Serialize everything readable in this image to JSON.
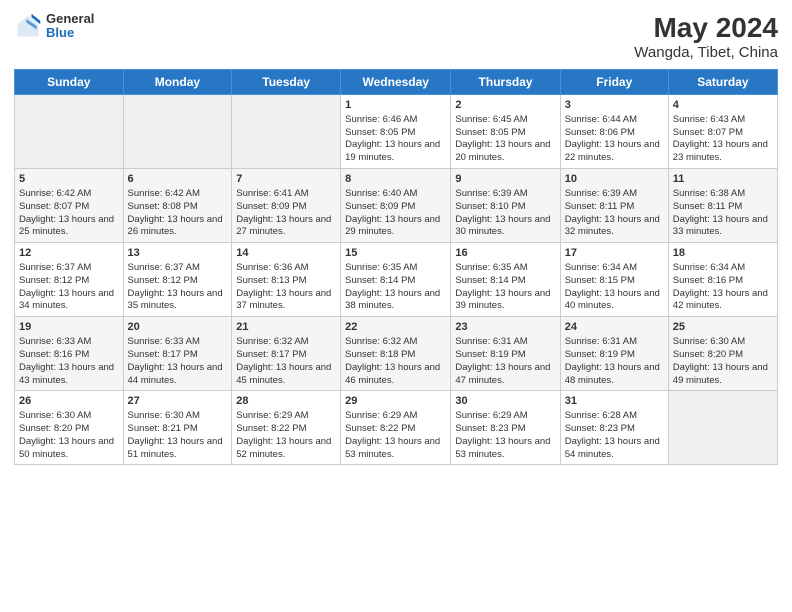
{
  "header": {
    "logo_general": "General",
    "logo_blue": "Blue",
    "title": "May 2024",
    "subtitle": "Wangda, Tibet, China"
  },
  "weekdays": [
    "Sunday",
    "Monday",
    "Tuesday",
    "Wednesday",
    "Thursday",
    "Friday",
    "Saturday"
  ],
  "rows": [
    [
      {
        "day": "",
        "info": ""
      },
      {
        "day": "",
        "info": ""
      },
      {
        "day": "",
        "info": ""
      },
      {
        "day": "1",
        "info": "Sunrise: 6:46 AM\nSunset: 8:05 PM\nDaylight: 13 hours and 19 minutes."
      },
      {
        "day": "2",
        "info": "Sunrise: 6:45 AM\nSunset: 8:05 PM\nDaylight: 13 hours and 20 minutes."
      },
      {
        "day": "3",
        "info": "Sunrise: 6:44 AM\nSunset: 8:06 PM\nDaylight: 13 hours and 22 minutes."
      },
      {
        "day": "4",
        "info": "Sunrise: 6:43 AM\nSunset: 8:07 PM\nDaylight: 13 hours and 23 minutes."
      }
    ],
    [
      {
        "day": "5",
        "info": "Sunrise: 6:42 AM\nSunset: 8:07 PM\nDaylight: 13 hours and 25 minutes."
      },
      {
        "day": "6",
        "info": "Sunrise: 6:42 AM\nSunset: 8:08 PM\nDaylight: 13 hours and 26 minutes."
      },
      {
        "day": "7",
        "info": "Sunrise: 6:41 AM\nSunset: 8:09 PM\nDaylight: 13 hours and 27 minutes."
      },
      {
        "day": "8",
        "info": "Sunrise: 6:40 AM\nSunset: 8:09 PM\nDaylight: 13 hours and 29 minutes."
      },
      {
        "day": "9",
        "info": "Sunrise: 6:39 AM\nSunset: 8:10 PM\nDaylight: 13 hours and 30 minutes."
      },
      {
        "day": "10",
        "info": "Sunrise: 6:39 AM\nSunset: 8:11 PM\nDaylight: 13 hours and 32 minutes."
      },
      {
        "day": "11",
        "info": "Sunrise: 6:38 AM\nSunset: 8:11 PM\nDaylight: 13 hours and 33 minutes."
      }
    ],
    [
      {
        "day": "12",
        "info": "Sunrise: 6:37 AM\nSunset: 8:12 PM\nDaylight: 13 hours and 34 minutes."
      },
      {
        "day": "13",
        "info": "Sunrise: 6:37 AM\nSunset: 8:12 PM\nDaylight: 13 hours and 35 minutes."
      },
      {
        "day": "14",
        "info": "Sunrise: 6:36 AM\nSunset: 8:13 PM\nDaylight: 13 hours and 37 minutes."
      },
      {
        "day": "15",
        "info": "Sunrise: 6:35 AM\nSunset: 8:14 PM\nDaylight: 13 hours and 38 minutes."
      },
      {
        "day": "16",
        "info": "Sunrise: 6:35 AM\nSunset: 8:14 PM\nDaylight: 13 hours and 39 minutes."
      },
      {
        "day": "17",
        "info": "Sunrise: 6:34 AM\nSunset: 8:15 PM\nDaylight: 13 hours and 40 minutes."
      },
      {
        "day": "18",
        "info": "Sunrise: 6:34 AM\nSunset: 8:16 PM\nDaylight: 13 hours and 42 minutes."
      }
    ],
    [
      {
        "day": "19",
        "info": "Sunrise: 6:33 AM\nSunset: 8:16 PM\nDaylight: 13 hours and 43 minutes."
      },
      {
        "day": "20",
        "info": "Sunrise: 6:33 AM\nSunset: 8:17 PM\nDaylight: 13 hours and 44 minutes."
      },
      {
        "day": "21",
        "info": "Sunrise: 6:32 AM\nSunset: 8:17 PM\nDaylight: 13 hours and 45 minutes."
      },
      {
        "day": "22",
        "info": "Sunrise: 6:32 AM\nSunset: 8:18 PM\nDaylight: 13 hours and 46 minutes."
      },
      {
        "day": "23",
        "info": "Sunrise: 6:31 AM\nSunset: 8:19 PM\nDaylight: 13 hours and 47 minutes."
      },
      {
        "day": "24",
        "info": "Sunrise: 6:31 AM\nSunset: 8:19 PM\nDaylight: 13 hours and 48 minutes."
      },
      {
        "day": "25",
        "info": "Sunrise: 6:30 AM\nSunset: 8:20 PM\nDaylight: 13 hours and 49 minutes."
      }
    ],
    [
      {
        "day": "26",
        "info": "Sunrise: 6:30 AM\nSunset: 8:20 PM\nDaylight: 13 hours and 50 minutes."
      },
      {
        "day": "27",
        "info": "Sunrise: 6:30 AM\nSunset: 8:21 PM\nDaylight: 13 hours and 51 minutes."
      },
      {
        "day": "28",
        "info": "Sunrise: 6:29 AM\nSunset: 8:22 PM\nDaylight: 13 hours and 52 minutes."
      },
      {
        "day": "29",
        "info": "Sunrise: 6:29 AM\nSunset: 8:22 PM\nDaylight: 13 hours and 53 minutes."
      },
      {
        "day": "30",
        "info": "Sunrise: 6:29 AM\nSunset: 8:23 PM\nDaylight: 13 hours and 53 minutes."
      },
      {
        "day": "31",
        "info": "Sunrise: 6:28 AM\nSunset: 8:23 PM\nDaylight: 13 hours and 54 minutes."
      },
      {
        "day": "",
        "info": ""
      }
    ]
  ]
}
